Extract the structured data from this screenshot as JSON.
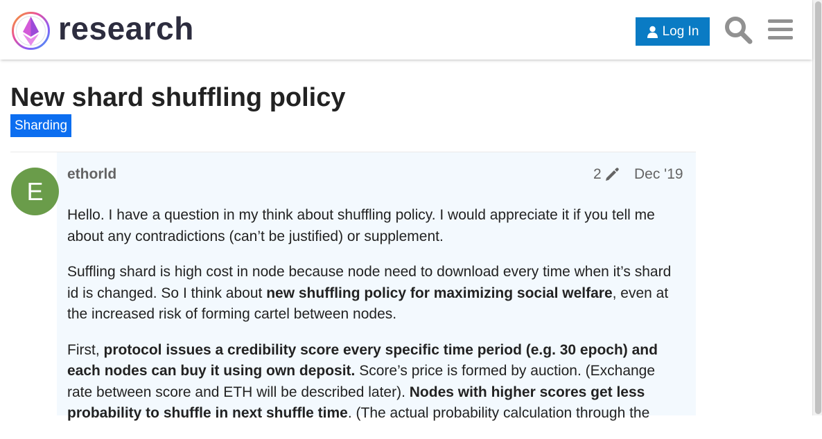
{
  "header": {
    "brand": "research",
    "login_label": "Log In"
  },
  "topic": {
    "title": "New shard shuffling policy",
    "category": "Sharding"
  },
  "post": {
    "avatar_letter": "E",
    "username": "ethorld",
    "edit_count": "2",
    "date": "Dec '19",
    "paragraphs": [
      [
        {
          "t": "Hello. I have a question in my think about shuffling policy. I would appreciate it if you tell me about any contradictions (can’t be justified) or supplement."
        }
      ],
      [
        {
          "t": "Suffling shard is high cost in node because node need to download every time when it’s shard id is changed. So I think about "
        },
        {
          "t": "new shuffling policy for maximizing social welfare",
          "b": true
        },
        {
          "t": ", even at the increased risk of forming cartel between nodes."
        }
      ],
      [
        {
          "t": "First, "
        },
        {
          "t": "protocol issues a credibility score every specific time period (e.g. 30 epoch) and each nodes can buy it using own deposit.",
          "b": true
        },
        {
          "t": " Score’s price is formed by auction. (Exchange rate between score and ETH will be described later). "
        },
        {
          "t": "Nodes with higher scores get less probability to shuffle in next shuffle time",
          "b": true
        },
        {
          "t": ". (The actual probability calculation through the"
        }
      ]
    ]
  },
  "colors": {
    "accent": "#0a7bc4",
    "category": "#0c6ef0",
    "avatar": "#6a9c4a",
    "post_bg": "#f3f9fe"
  },
  "icons": {
    "logo": "ethereum-research-logo",
    "login": "user-icon",
    "search": "search-icon",
    "menu": "hamburger-menu-icon",
    "edit": "pencil-icon"
  }
}
